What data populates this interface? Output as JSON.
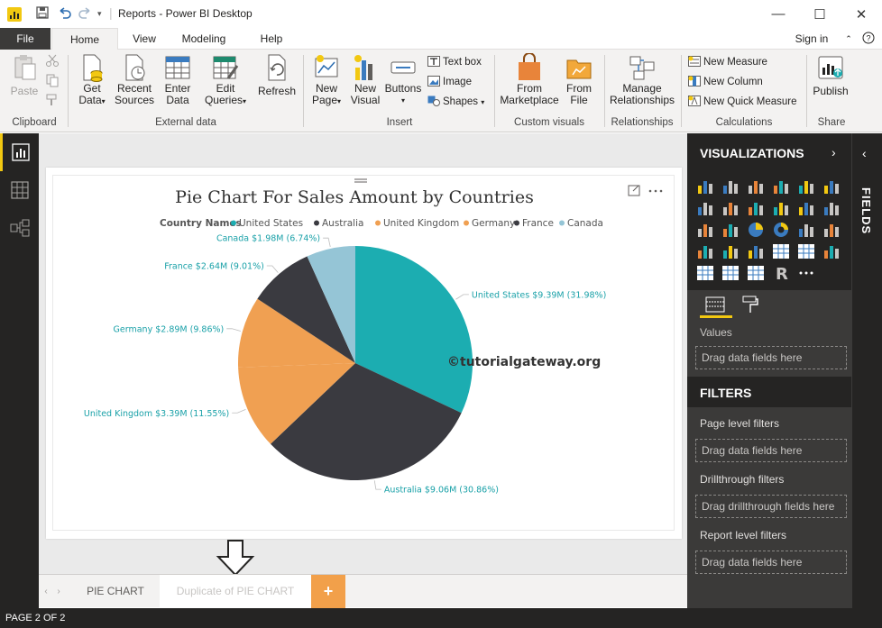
{
  "window": {
    "title": "Reports - Power BI Desktop",
    "controls": {
      "minimize": "—",
      "maximize": "☐",
      "close": "✕"
    }
  },
  "ribbon_tabs": [
    "File",
    "Home",
    "View",
    "Modeling",
    "Help"
  ],
  "user": {
    "sign_in": "Sign in"
  },
  "ribbon": {
    "clipboard": {
      "paste": "Paste",
      "group": "Clipboard"
    },
    "external_data": {
      "get_data": "Get Data",
      "recent_sources": "Recent Sources",
      "enter_data": "Enter Data",
      "edit_queries": "Edit Queries",
      "refresh": "Refresh",
      "group": "External data"
    },
    "insert": {
      "new_page": "New Page",
      "new_visual": "New Visual",
      "buttons": "Buttons",
      "text_box": "Text box",
      "image": "Image",
      "shapes": "Shapes",
      "group": "Insert"
    },
    "custom_visuals": {
      "from_marketplace": "From Marketplace",
      "from_file": "From File",
      "group": "Custom visuals"
    },
    "relationships": {
      "manage": "Manage Relationships",
      "group": "Relationships"
    },
    "calculations": {
      "new_measure": "New Measure",
      "new_column": "New Column",
      "new_quick_measure": "New Quick Measure",
      "group": "Calculations"
    },
    "share": {
      "publish": "Publish",
      "group": "Share"
    }
  },
  "watermark": "©tutorialgateway.org",
  "chart_data": {
    "type": "pie",
    "title": "Pie Chart For Sales Amount by Countries",
    "legend_title": "Country Names",
    "legend_position": "top",
    "slices": [
      {
        "name": "United States",
        "value": 9.39,
        "label": "United States $9.39M (31.98%)",
        "color": "#01b8aa"
      },
      {
        "name": "Australia",
        "value": 9.06,
        "label": "Australia $9.06M (30.86%)",
        "color": "#374649"
      },
      {
        "name": "United Kingdom",
        "value": 3.39,
        "label": "United Kingdom $3.39M (11.55%)",
        "color": "#fd625e"
      },
      {
        "name": "Germany",
        "value": 2.89,
        "label": "Germany $2.89M (9.86%)",
        "color": "#f2c80f"
      },
      {
        "name": "France",
        "value": 2.64,
        "label": "France $2.64M (9.01%)",
        "color": "#5f6b6d"
      },
      {
        "name": "Canada",
        "value": 1.98,
        "label": "Canada $1.98M (6.74%)",
        "color": "#8ad4eb"
      }
    ]
  },
  "slice_colors": {
    "United States": "#1cadb1",
    "Australia": "#3a3a40",
    "United Kingdom": "#f0a052",
    "Germany": "#f0a052",
    "France": "#3a3a40",
    "Canada": "#95c5d6"
  },
  "page_tabs": [
    "PIE CHART",
    "Duplicate of PIE CHART"
  ],
  "add_page": "+",
  "status": "PAGE 2 OF 2",
  "panel": {
    "visualizations": "VISUALIZATIONS",
    "fields": "FIELDS",
    "values_label": "Values",
    "drag_values": "Drag data fields here",
    "filters": "FILTERS",
    "page_level": "Page level filters",
    "drag_page": "Drag data fields here",
    "drillthrough": "Drillthrough filters",
    "drag_drillthrough": "Drag drillthrough fields here",
    "report_level": "Report level filters",
    "drag_report": "Drag data fields here"
  }
}
